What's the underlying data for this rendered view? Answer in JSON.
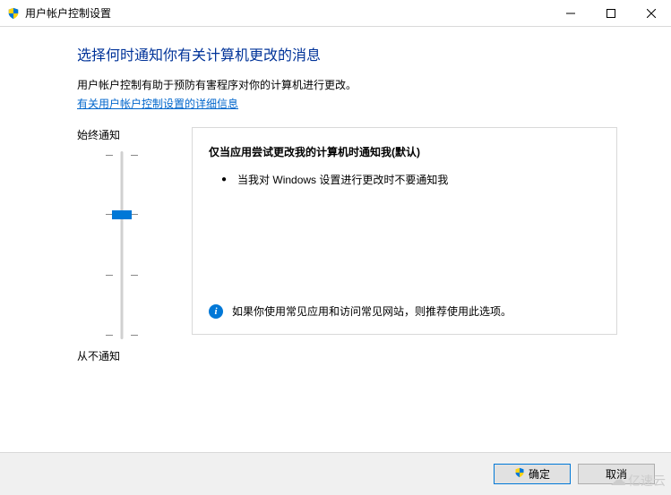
{
  "titlebar": {
    "title": "用户帐户控制设置"
  },
  "heading": "选择何时通知你有关计算机更改的消息",
  "description": "用户帐户控制有助于预防有害程序对你的计算机进行更改。",
  "link_text": "有关用户帐户控制设置的详细信息",
  "slider": {
    "top_label": "始终通知",
    "bottom_label": "从不通知",
    "levels": 4,
    "current_level": 2
  },
  "panel": {
    "title": "仅当应用尝试更改我的计算机时通知我(默认)",
    "bullet": "当我对 Windows 设置进行更改时不要通知我",
    "info": "如果你使用常见应用和访问常见网站，则推荐使用此选项。"
  },
  "buttons": {
    "ok": "确定",
    "cancel": "取消"
  },
  "watermark": "亿速云"
}
